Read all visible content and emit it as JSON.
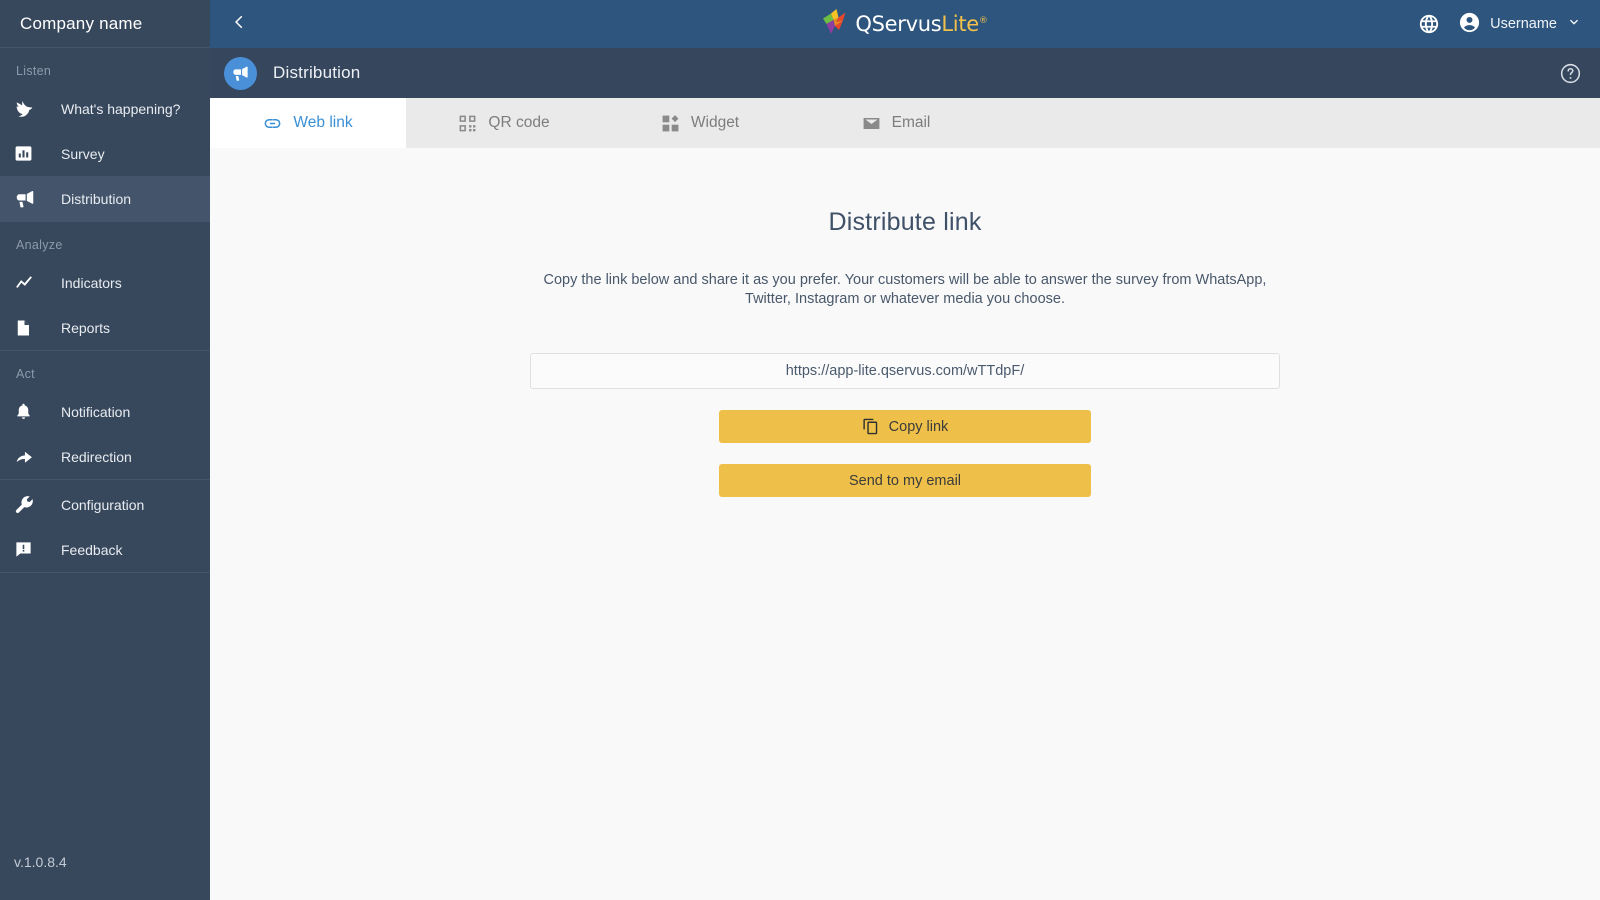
{
  "sidebar": {
    "company_name": "Company name",
    "version": "v.1.0.8.4",
    "groups": [
      {
        "label": "Listen",
        "items": [
          {
            "label": "What's happening?",
            "icon": "bird-icon",
            "active": false
          },
          {
            "label": "Survey",
            "icon": "bar-chart-icon",
            "active": false
          },
          {
            "label": "Distribution",
            "icon": "megaphone-icon",
            "active": true
          }
        ]
      },
      {
        "label": "Analyze",
        "items": [
          {
            "label": "Indicators",
            "icon": "trend-line-icon",
            "active": false
          },
          {
            "label": "Reports",
            "icon": "document-icon",
            "active": false
          }
        ]
      },
      {
        "label": "Act",
        "items": [
          {
            "label": "Notification",
            "icon": "bell-icon",
            "active": false
          },
          {
            "label": "Redirection",
            "icon": "arrow-redirect-icon",
            "active": false
          }
        ]
      },
      {
        "label": "",
        "items": [
          {
            "label": "Configuration",
            "icon": "wrench-icon",
            "active": false
          },
          {
            "label": "Feedback",
            "icon": "comment-alert-icon",
            "active": false
          }
        ]
      }
    ]
  },
  "topbar": {
    "back_icon": "chevron-left-icon",
    "logo_primary": "QServus",
    "logo_secondary": "Lite",
    "logo_registered": "®",
    "language_icon": "globe-icon",
    "account_icon": "user-circle-icon",
    "username": "Username",
    "dropdown_icon": "chevron-down-icon"
  },
  "subbar": {
    "page_icon": "megaphone-icon",
    "title": "Distribution",
    "help_icon": "help-circle-icon"
  },
  "tabs": [
    {
      "label": "Web link",
      "icon": "link-icon",
      "active": true
    },
    {
      "label": "QR code",
      "icon": "qr-code-icon",
      "active": false
    },
    {
      "label": "Widget",
      "icon": "widget-icon",
      "active": false
    },
    {
      "label": "Email",
      "icon": "envelope-icon",
      "active": false
    }
  ],
  "main": {
    "heading": "Distribute link",
    "description": "Copy the link below and share it as you prefer. Your customers will be able to answer the survey from WhatsApp, Twitter, Instagram or whatever media you choose.",
    "link_value": "https://app-lite.qservus.com/wTTdpF/",
    "copy_button_label": "Copy link",
    "copy_button_icon": "copy-icon",
    "email_button_label": "Send to my email"
  },
  "colors": {
    "sidebar_bg": "#37475c",
    "sidebar_active": "#44556b",
    "topbar_bg": "#2d557e",
    "subbar_bg": "#36465c",
    "tabbar_bg": "#eaeaea",
    "content_bg": "#f9f9f9",
    "accent_yellow": "#eec04a",
    "accent_blue": "#3a8fd4",
    "page_icon_bg": "#4a90d9"
  }
}
